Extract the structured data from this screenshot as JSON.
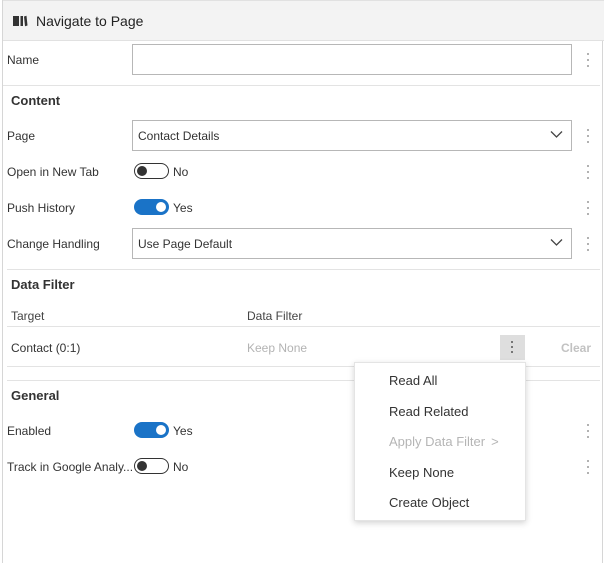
{
  "header": {
    "title": "Navigate to Page"
  },
  "name_row": {
    "label": "Name",
    "value": ""
  },
  "content": {
    "title": "Content",
    "page": {
      "label": "Page",
      "value": "Contact Details"
    },
    "open_new_tab": {
      "label": "Open in New Tab",
      "state": "No",
      "on": false
    },
    "push_history": {
      "label": "Push History",
      "state": "Yes",
      "on": true
    },
    "change_handling": {
      "label": "Change Handling",
      "value": "Use Page Default"
    }
  },
  "data_filter": {
    "title": "Data Filter",
    "columns": [
      "Target",
      "Data Filter"
    ],
    "rows": [
      {
        "target": "Contact (0:1)",
        "filter": "Keep None",
        "clear": "Clear"
      }
    ]
  },
  "general": {
    "title": "General",
    "enabled": {
      "label": "Enabled",
      "state": "Yes",
      "on": true
    },
    "track_ga": {
      "label": "Track in Google Analy...",
      "state": "No",
      "on": false
    }
  },
  "context_menu": {
    "items": [
      {
        "label": "Read All",
        "disabled": false
      },
      {
        "label": "Read Related",
        "disabled": false
      },
      {
        "label": "Apply Data Filter",
        "disabled": true,
        "submenu_glyph": ">"
      },
      {
        "label": "Keep None",
        "disabled": false
      },
      {
        "label": "Create Object",
        "disabled": false
      }
    ]
  },
  "colors": {
    "accent": "#1a73c7",
    "header_bg": "#f3f3f3",
    "disabled_text": "#b3b3b3"
  },
  "icons": {
    "header": "book-icon",
    "dropdown": "chevron-down-icon",
    "more": "kebab-icon"
  }
}
